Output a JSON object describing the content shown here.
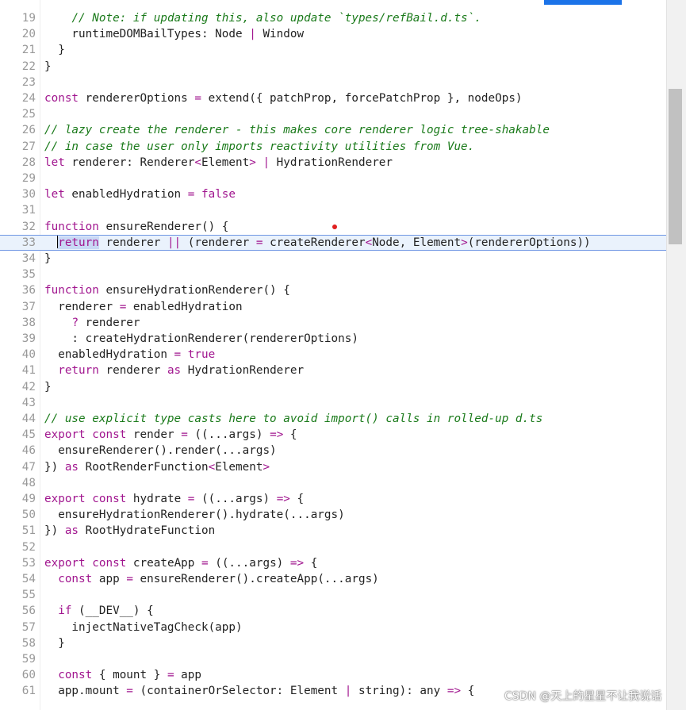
{
  "colors": {
    "keyword": "#a1168f",
    "comment": "#1a7a1a",
    "line_number": "#999999",
    "active_line_bg": "#eaf2fc",
    "active_line_border": "#6f96e3",
    "selection": "#c9d8f5"
  },
  "editor": {
    "lines": [
      {
        "n": "19",
        "segs": [
          {
            "t": "    "
          },
          {
            "t": "// Note: if updating this, also update `types/refBail.d.ts`.",
            "c": "cm"
          }
        ]
      },
      {
        "n": "20",
        "segs": [
          {
            "t": "    runtimeDOMBailTypes: Node "
          },
          {
            "t": "|",
            "c": "op"
          },
          {
            "t": " Window"
          }
        ]
      },
      {
        "n": "21",
        "segs": [
          {
            "t": "  }"
          }
        ]
      },
      {
        "n": "22",
        "segs": [
          {
            "t": "}"
          }
        ]
      },
      {
        "n": "23",
        "segs": []
      },
      {
        "n": "24",
        "segs": [
          {
            "t": "const",
            "c": "kw"
          },
          {
            "t": " rendererOptions "
          },
          {
            "t": "=",
            "c": "op"
          },
          {
            "t": " extend({ patchProp, forcePatchProp }, nodeOps)"
          }
        ]
      },
      {
        "n": "25",
        "segs": []
      },
      {
        "n": "26",
        "segs": [
          {
            "t": "// lazy create the renderer - this makes core renderer logic tree-shakable",
            "c": "cm"
          }
        ]
      },
      {
        "n": "27",
        "segs": [
          {
            "t": "// in case the user only imports reactivity utilities from Vue.",
            "c": "cm"
          }
        ]
      },
      {
        "n": "28",
        "segs": [
          {
            "t": "let",
            "c": "kw"
          },
          {
            "t": " renderer: Renderer"
          },
          {
            "t": "<",
            "c": "op"
          },
          {
            "t": "Element"
          },
          {
            "t": ">",
            "c": "op"
          },
          {
            "t": " "
          },
          {
            "t": "|",
            "c": "op"
          },
          {
            "t": " HydrationRenderer"
          }
        ]
      },
      {
        "n": "29",
        "segs": []
      },
      {
        "n": "30",
        "segs": [
          {
            "t": "let",
            "c": "kw"
          },
          {
            "t": " enabledHydration "
          },
          {
            "t": "=",
            "c": "op"
          },
          {
            "t": " "
          },
          {
            "t": "false",
            "c": "bool"
          }
        ]
      },
      {
        "n": "31",
        "segs": []
      },
      {
        "n": "32",
        "segs": [
          {
            "t": "function",
            "c": "kw"
          },
          {
            "t": " ensureRenderer() {"
          }
        ]
      },
      {
        "n": "33",
        "active": true,
        "segs": [
          {
            "t": "  "
          },
          {
            "caret": true
          },
          {
            "t": "return",
            "c": "kw sel"
          },
          {
            "t": " renderer "
          },
          {
            "t": "||",
            "c": "op"
          },
          {
            "t": " (renderer "
          },
          {
            "t": "=",
            "c": "op"
          },
          {
            "t": " createRenderer"
          },
          {
            "t": "<",
            "c": "op"
          },
          {
            "t": "Node, Element"
          },
          {
            "t": ">",
            "c": "op"
          },
          {
            "t": "(rendererOptions))"
          }
        ]
      },
      {
        "n": "34",
        "segs": [
          {
            "t": "}"
          }
        ]
      },
      {
        "n": "35",
        "segs": []
      },
      {
        "n": "36",
        "segs": [
          {
            "t": "function",
            "c": "kw"
          },
          {
            "t": " ensureHydrationRenderer() {"
          }
        ]
      },
      {
        "n": "37",
        "segs": [
          {
            "t": "  renderer "
          },
          {
            "t": "=",
            "c": "op"
          },
          {
            "t": " enabledHydration"
          }
        ]
      },
      {
        "n": "38",
        "segs": [
          {
            "t": "    "
          },
          {
            "t": "?",
            "c": "op"
          },
          {
            "t": " renderer"
          }
        ]
      },
      {
        "n": "39",
        "segs": [
          {
            "t": "    : createHydrationRenderer(rendererOptions)"
          }
        ]
      },
      {
        "n": "40",
        "segs": [
          {
            "t": "  enabledHydration "
          },
          {
            "t": "=",
            "c": "op"
          },
          {
            "t": " "
          },
          {
            "t": "true",
            "c": "bool"
          }
        ]
      },
      {
        "n": "41",
        "segs": [
          {
            "t": "  "
          },
          {
            "t": "return",
            "c": "kw"
          },
          {
            "t": " renderer "
          },
          {
            "t": "as",
            "c": "kw"
          },
          {
            "t": " HydrationRenderer"
          }
        ]
      },
      {
        "n": "42",
        "segs": [
          {
            "t": "}"
          }
        ]
      },
      {
        "n": "43",
        "segs": []
      },
      {
        "n": "44",
        "segs": [
          {
            "t": "// use explicit type casts here to avoid import() calls in rolled-up d.ts",
            "c": "cm"
          }
        ]
      },
      {
        "n": "45",
        "segs": [
          {
            "t": "export",
            "c": "kw"
          },
          {
            "t": " "
          },
          {
            "t": "const",
            "c": "kw"
          },
          {
            "t": " render "
          },
          {
            "t": "=",
            "c": "op"
          },
          {
            "t": " ((...args) "
          },
          {
            "t": "=>",
            "c": "op"
          },
          {
            "t": " {"
          }
        ]
      },
      {
        "n": "46",
        "segs": [
          {
            "t": "  ensureRenderer().render(...args)"
          }
        ]
      },
      {
        "n": "47",
        "segs": [
          {
            "t": "}) "
          },
          {
            "t": "as",
            "c": "kw"
          },
          {
            "t": " RootRenderFunction"
          },
          {
            "t": "<",
            "c": "op"
          },
          {
            "t": "Element"
          },
          {
            "t": ">",
            "c": "op"
          }
        ]
      },
      {
        "n": "48",
        "segs": []
      },
      {
        "n": "49",
        "segs": [
          {
            "t": "export",
            "c": "kw"
          },
          {
            "t": " "
          },
          {
            "t": "const",
            "c": "kw"
          },
          {
            "t": " hydrate "
          },
          {
            "t": "=",
            "c": "op"
          },
          {
            "t": " ((...args) "
          },
          {
            "t": "=>",
            "c": "op"
          },
          {
            "t": " {"
          }
        ]
      },
      {
        "n": "50",
        "segs": [
          {
            "t": "  ensureHydrationRenderer().hydrate(...args)"
          }
        ]
      },
      {
        "n": "51",
        "segs": [
          {
            "t": "}) "
          },
          {
            "t": "as",
            "c": "kw"
          },
          {
            "t": " RootHydrateFunction"
          }
        ]
      },
      {
        "n": "52",
        "segs": []
      },
      {
        "n": "53",
        "segs": [
          {
            "t": "export",
            "c": "kw"
          },
          {
            "t": " "
          },
          {
            "t": "const",
            "c": "kw"
          },
          {
            "t": " createApp "
          },
          {
            "t": "=",
            "c": "op"
          },
          {
            "t": " ((...args) "
          },
          {
            "t": "=>",
            "c": "op"
          },
          {
            "t": " {"
          }
        ]
      },
      {
        "n": "54",
        "segs": [
          {
            "t": "  "
          },
          {
            "t": "const",
            "c": "kw"
          },
          {
            "t": " app "
          },
          {
            "t": "=",
            "c": "op"
          },
          {
            "t": " ensureRenderer().createApp(...args)"
          }
        ]
      },
      {
        "n": "55",
        "segs": []
      },
      {
        "n": "56",
        "segs": [
          {
            "t": "  "
          },
          {
            "t": "if",
            "c": "kw"
          },
          {
            "t": " (__DEV__) {"
          }
        ]
      },
      {
        "n": "57",
        "segs": [
          {
            "t": "    injectNativeTagCheck(app)"
          }
        ]
      },
      {
        "n": "58",
        "segs": [
          {
            "t": "  }"
          }
        ]
      },
      {
        "n": "59",
        "segs": []
      },
      {
        "n": "60",
        "segs": [
          {
            "t": "  "
          },
          {
            "t": "const",
            "c": "kw"
          },
          {
            "t": " { mount } "
          },
          {
            "t": "=",
            "c": "op"
          },
          {
            "t": " app"
          }
        ]
      },
      {
        "n": "61",
        "segs": [
          {
            "t": "  app.mount "
          },
          {
            "t": "=",
            "c": "op"
          },
          {
            "t": " (containerOrSelector: Element "
          },
          {
            "t": "|",
            "c": "op"
          },
          {
            "t": " string): any "
          },
          {
            "t": "=>",
            "c": "op"
          },
          {
            "t": " {"
          }
        ]
      }
    ]
  },
  "watermark": "CSDN @天上的星星不让我说话"
}
